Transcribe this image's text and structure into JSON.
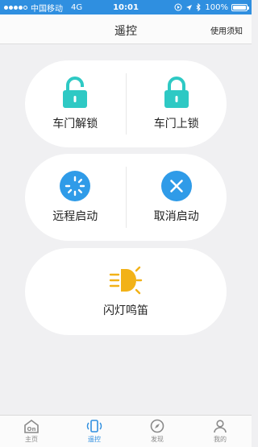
{
  "status_bar": {
    "carrier": "中国移动",
    "network": "4G",
    "time": "10:01",
    "battery": "100%"
  },
  "nav": {
    "title": "遥控",
    "action_label": "使用须知"
  },
  "controls": {
    "unlock_label": "车门解锁",
    "lock_label": "车门上锁",
    "remote_start_label": "远程启动",
    "cancel_start_label": "取消启动",
    "flash_horn_label": "闪灯鸣笛"
  },
  "icons": {
    "unlock": "unlock-icon",
    "lock": "lock-icon",
    "remote_start": "spinner-icon",
    "cancel_start": "close-icon",
    "flash_horn": "headlight-icon"
  },
  "colors": {
    "accent": "#2f8fe0",
    "lock_teal": "#2ec9c4",
    "start_blue": "#2f9be8",
    "flash_yellow": "#f2b218"
  },
  "tabs": [
    {
      "label": "主页",
      "icon": "home-icon"
    },
    {
      "label": "遥控",
      "icon": "remote-icon"
    },
    {
      "label": "发现",
      "icon": "compass-icon"
    },
    {
      "label": "我的",
      "icon": "user-icon"
    }
  ]
}
